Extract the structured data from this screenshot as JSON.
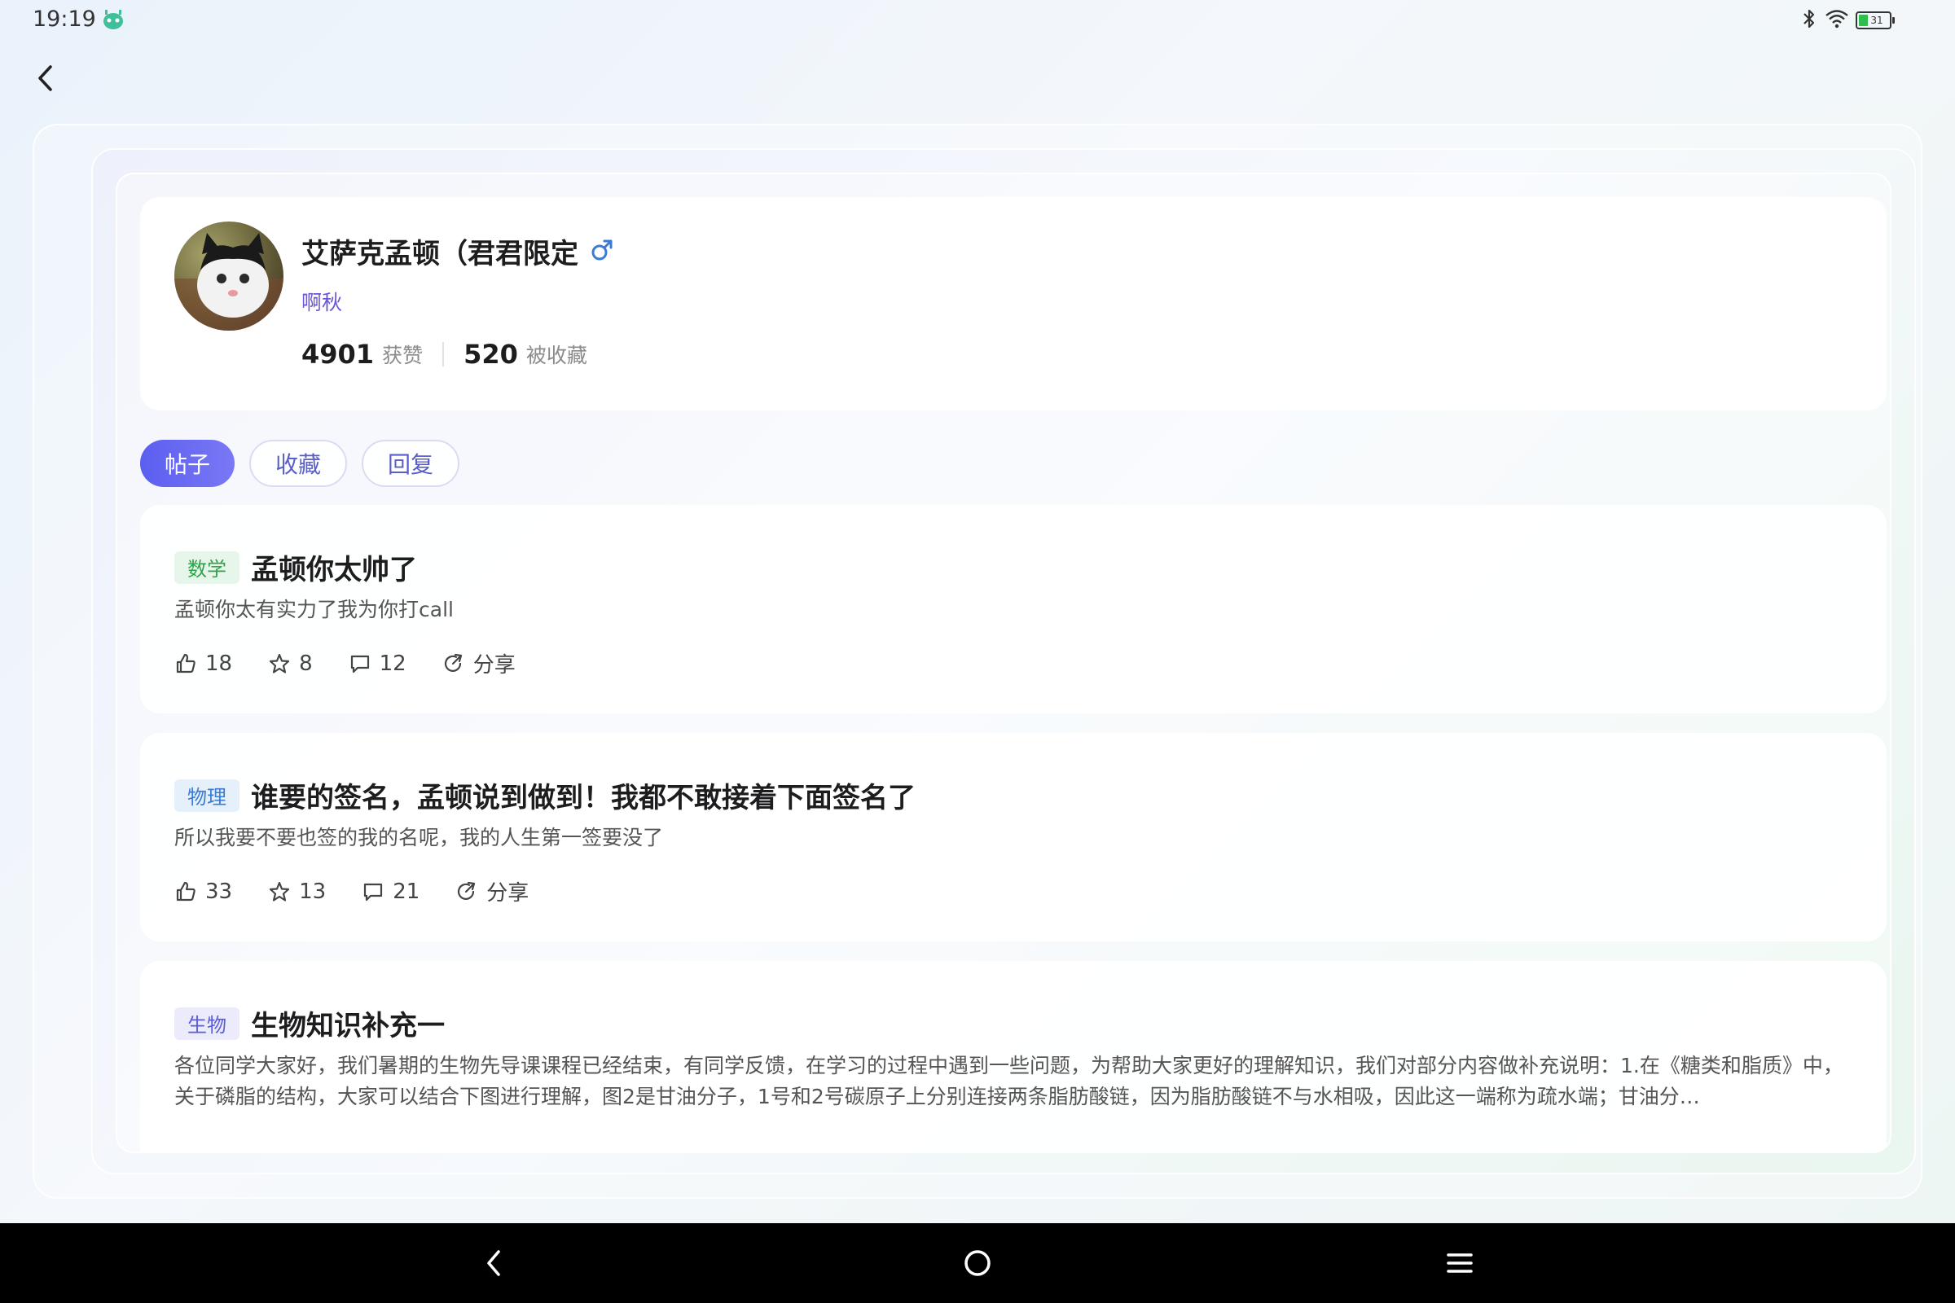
{
  "status_bar": {
    "time": "19:19",
    "app_icon": "robot-app-icon",
    "battery_level": "31",
    "battery_fraction": 0.31
  },
  "profile": {
    "name": "艾萨克孟顿（君君限定",
    "gender_icon": "male-icon",
    "subtitle": "啊秋",
    "likes_value": "4901",
    "likes_label": "获赞",
    "favorites_value": "520",
    "favorites_label": "被收藏"
  },
  "tabs": [
    {
      "label": "帖子",
      "active": true
    },
    {
      "label": "收藏",
      "active": false
    },
    {
      "label": "回复",
      "active": false
    }
  ],
  "posts": [
    {
      "tag": "数学",
      "tag_color": "#2fa34a",
      "tag_bg": "#e7f6ea",
      "title": "孟顿你太帅了",
      "body": "孟顿你太有实力了我为你打call",
      "likes": "18",
      "favorites": "8",
      "comments": "12",
      "share_label": "分享"
    },
    {
      "tag": "物理",
      "tag_color": "#3a7bd5",
      "tag_bg": "#e6f0fb",
      "title": "谁要的签名，孟顿说到做到！我都不敢接着下面签名了",
      "body": "所以我要不要也签的我的名呢，我的人生第一签要没了",
      "likes": "33",
      "favorites": "13",
      "comments": "21",
      "share_label": "分享"
    },
    {
      "tag": "生物",
      "tag_color": "#5b5ed6",
      "tag_bg": "#ecebfb",
      "title": "生物知识补充一",
      "body": "各位同学大家好，我们暑期的生物先导课课程已经结束，有同学反馈，在学习的过程中遇到一些问题，为帮助大家更好的理解知识，我们对部分内容做补充说明：1.在《糖类和脂质》中，关于磷脂的结构，大家可以结合下图进行理解，图2是甘油分子，1号和2号碳原子上分别连接两条脂肪酸链，因为脂肪酸链不与水相吸，因此这一端称为疏水端；甘油分…"
    }
  ],
  "colors": {
    "accent": "#5b5ff0",
    "tab_inactive_text": "#5a5ec9",
    "subtitle": "#6b57d6",
    "male_icon": "#3a7bd5"
  },
  "nav_bar": {
    "back_icon": "nav-back-icon",
    "home_icon": "nav-home-icon",
    "menu_icon": "nav-menu-icon"
  }
}
